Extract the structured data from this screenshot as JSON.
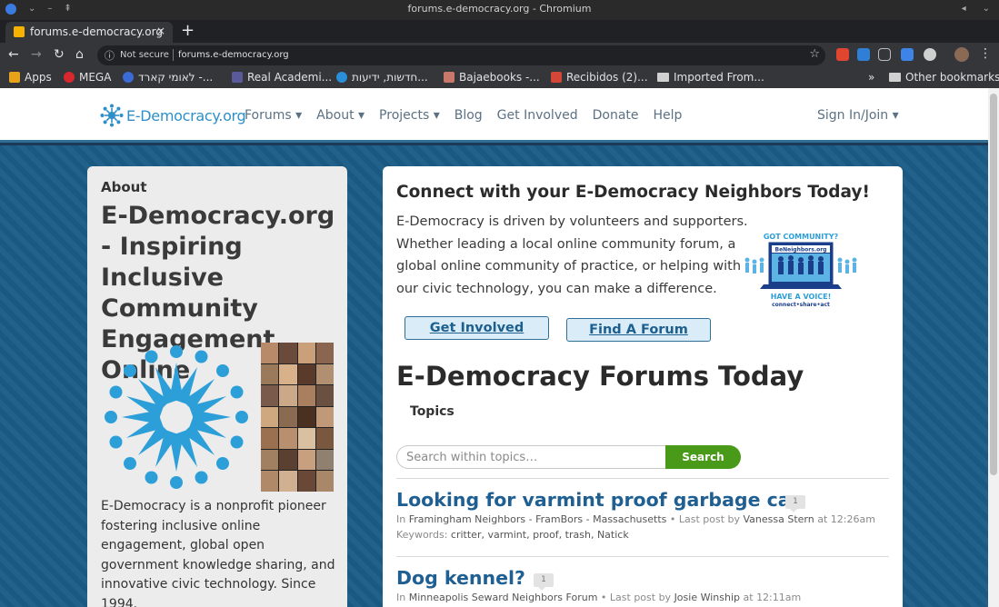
{
  "window": {
    "title": "forums.e-democracy.org - Chromium"
  },
  "tab": {
    "label": "forums.e-democracy.org",
    "close": "×",
    "new_tab": "+"
  },
  "omnibox": {
    "security": "Not secure",
    "url": "forums.e-democracy.org"
  },
  "bookmarks": [
    {
      "label": "Apps",
      "icon": "apps-grid-icon",
      "color": "#e8a31b"
    },
    {
      "label": "MEGA",
      "icon": "mega-icon",
      "color": "#d9272e"
    },
    {
      "label": "לאומי קארד -...",
      "icon": "globe-icon",
      "color": "#3b6bd6"
    },
    {
      "label": "Real Academi...",
      "icon": "rae-icon",
      "color": "#5a5a9a"
    },
    {
      "label": "חדשות, ידיעות...",
      "icon": "ynet-icon",
      "color": "#2a8fd6"
    },
    {
      "label": "Bajaebooks -...",
      "icon": "bajaebooks-icon",
      "color": "#c9776b"
    },
    {
      "label": "Recibidos (2)...",
      "icon": "gmail-icon",
      "color": "#d44638"
    },
    {
      "label": "Imported From...",
      "icon": "folder-icon",
      "color": "#d0d0d0"
    }
  ],
  "bookmarks_more": "»",
  "other_bookmarks": "Other bookmarks",
  "site": {
    "logo_text": "E-Democracy.org",
    "nav": [
      {
        "label": "Forums ▾",
        "name": "nav-forums"
      },
      {
        "label": "About ▾",
        "name": "nav-about"
      },
      {
        "label": "Projects ▾",
        "name": "nav-projects"
      },
      {
        "label": "Blog",
        "name": "nav-blog"
      },
      {
        "label": "Get Involved",
        "name": "nav-get-involved"
      },
      {
        "label": "Donate",
        "name": "nav-donate"
      },
      {
        "label": "Help",
        "name": "nav-help"
      }
    ],
    "signin": "Sign In/Join ▾"
  },
  "about": {
    "label": "About",
    "title": "E-Democracy.org - Inspiring Inclusive Community Engagement Online",
    "description": "E-Democracy is a nonprofit pioneer fostering inclusive online engagement, global open government knowledge sharing, and innovative civic technology. Since 1994."
  },
  "connect": {
    "heading": "Connect with your E-Democracy Neighbors Today!",
    "intro": "E-Democracy is driven by volunteers and supporters. Whether leading a local online community forum, a global online community of practice, or helping with our civic technology, you can make a difference.",
    "badge_top": "GOT COMMUNITY?",
    "badge_site": "BeNeighbors.org",
    "badge_bottom": "HAVE A VOICE!",
    "badge_tagline": "connect•share•act",
    "get_involved": "Get Involved",
    "find_forum": "Find A Forum"
  },
  "forums": {
    "title": "E-Democracy Forums Today",
    "topics_label": "Topics",
    "search_placeholder": "Search within topics…",
    "search_button": "Search",
    "topics": [
      {
        "title": "Looking for varmint proof garbage can",
        "count": "1",
        "in_label": "In",
        "group": "Framingham Neighbors - FramBors - Massachusetts",
        "last_post_label": "• Last post by",
        "author": "Vanessa Stern",
        "at_label": "at",
        "time": "12:26am",
        "keywords_label": "Keywords:",
        "keywords": "critter, varmint, proof, trash, Natick"
      },
      {
        "title": "Dog kennel?",
        "count": "1",
        "in_label": "In",
        "group": "Minneapolis Seward Neighbors Forum",
        "last_post_label": "• Last post by",
        "author": "Josie Winship",
        "at_label": "at",
        "time": "12:11am"
      }
    ]
  },
  "colors": {
    "brand": "#2d8fc9",
    "link": "#1f5f91",
    "search_button": "#4a9a1a",
    "page_background": "#1b5c86"
  }
}
